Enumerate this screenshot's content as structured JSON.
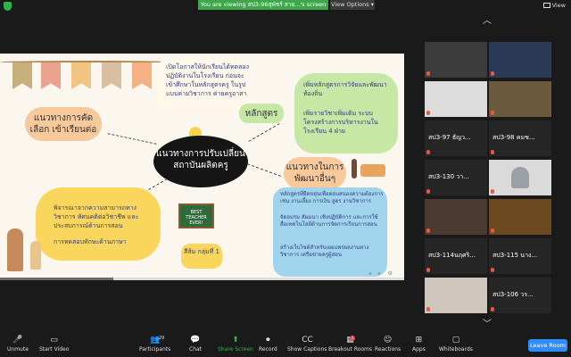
{
  "topbar": {
    "viewing_text": "You are viewing สป3-96สุพัชร์ สาย...'s screen",
    "view_options": "View Options",
    "view_label": "View"
  },
  "slide": {
    "title_left": "แนวทางการคัดเลือก เข้าเรียนต่อ",
    "center_title": "แนวทางการปรับเปลี่ยน สถาบันผลิตครู",
    "curriculum_title": "หลักสูตร",
    "develop_title": "แนวทางในการ พัฒนาอื่นๆ",
    "top_text": "เปิดโอกาสให้นักเรียนได้ทดลองปฏิบัติงานในโรงเรียน ก่อนจะเข้าศึกษาในหลักสูตรครู ในรูปแบบค่ายวิชาการ ค่ายครูอาสา",
    "curriculum_points": [
      "เพิ่มหลักสูตรการวิจัยและพัฒนาท้องถิ่น",
      "เพิ่มรายวิชาเพิ่มเติม ระบบโครงสร้างการบริหารงานในโรงเรียน 4 ฝ่าย"
    ],
    "selection_points": [
      "พิจารณาจากความสามารถทางวิชาการ ทัศนคติต่อวิชาชีพ และประสบการณ์ด้านการสอน",
      "การทดสอบทักษะด้านภาษา"
    ],
    "develop_points": [
      "หลักสูตรที่ยืดหยุ่นเพื่อตอบสนองความต้องการ เช่น งานเลี้ยง การเงิน สูตร งานวิชาการ",
      "จัดอบรม สัมมนา เชิงปฏิบัติการ และการใช้สื่อเทคโนโลยีด้านการจัดการเรียนการสอน",
      "สร้างเว็บไซต์สำหรับเผยแพร่ผลงานทางวิชาการ เครือข่ายครูผู้สอน"
    ],
    "board_text": "BEST TEACHER EVER!",
    "group_tag": "สีส้ม กลุ่มที่ 1",
    "progress": 0.28
  },
  "participants": [
    {
      "name": "",
      "type": "video"
    },
    {
      "name": "",
      "type": "video"
    },
    {
      "name": "",
      "type": "video"
    },
    {
      "name": "",
      "type": "video"
    },
    {
      "name": "สป3-97 ธัญว...",
      "type": "name"
    },
    {
      "name": "สป3-98 คมช...",
      "type": "name"
    },
    {
      "name": "สป3-130 วา...",
      "type": "name"
    },
    {
      "name": "",
      "type": "avatar"
    },
    {
      "name": "",
      "type": "video"
    },
    {
      "name": "",
      "type": "video"
    },
    {
      "name": "สป3-114นฤศริ...",
      "type": "name"
    },
    {
      "name": "สป3-115 นาง...",
      "type": "name"
    },
    {
      "name": "",
      "type": "video"
    },
    {
      "name": "สป3-106 วร...",
      "type": "name"
    }
  ],
  "toolbar": {
    "unmute": "Unmute",
    "start_video": "Start Video",
    "participants": "Participants",
    "participants_count": "29",
    "chat": "Chat",
    "share_screen": "Share Screen",
    "record": "Record",
    "show_captions": "Show Captions",
    "breakout_rooms": "Breakout Rooms",
    "reactions": "Reactions",
    "apps": "Apps",
    "whiteboards": "Whiteboards",
    "leave": "Leave Room"
  },
  "colors": {
    "accent_green": "#3da84a",
    "leave_blue": "#2d8cff"
  }
}
